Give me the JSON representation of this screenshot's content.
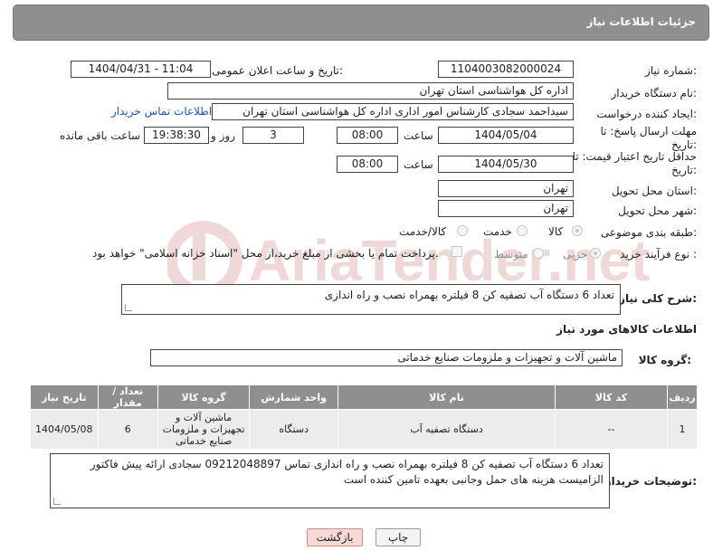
{
  "header": {
    "title": "جزئیات اطلاعات نیاز"
  },
  "fields": {
    "need_number_label": "شماره نیاز:",
    "need_number": "1104003082000024",
    "announce_label": "تاریخ و ساعت اعلان عمومی:",
    "announce_value": "1404/04/31 - 11:04",
    "buyer_org_label": "نام دستگاه خریدار:",
    "buyer_org": "اداره کل هواشناسی استان تهران",
    "requester_label": "ایجاد کننده درخواست:",
    "requester": "سیداحمد سجادی کارشناس امور اداری اداره کل هواشناسی استان تهران",
    "buyer_contact_link": "اطلاعات تماس خریدار",
    "deadline_label": "مهلت ارسال پاسخ: تا تاریخ:",
    "deadline_date": "1404/05/04",
    "time_label": "ساعت",
    "deadline_time": "08:00",
    "days_count": "3",
    "days_label": "روز و",
    "remaining_time": "19:38:30",
    "remaining_label": "ساعت باقی مانده",
    "validity_label": "حداقل تاریخ اعتبار قیمت: تا تاریخ:",
    "validity_date": "1404/05/30",
    "validity_time": "08:00",
    "province_label": "استان محل تحویل:",
    "province": "تهران",
    "city_label": "شهر محل تحویل:",
    "city": "تهران",
    "category_label": "طبقه بندی موضوعی:",
    "category_options": [
      "کالا",
      "خدمت",
      "کالا/خدمت"
    ],
    "process_label": "نوع فرآیند خرید :",
    "process_options": [
      "جزیی",
      "متوسط"
    ],
    "payment_note": "پرداخت تمام یا بخشی از مبلغ خرید،از محل \"اسناد خزانه اسلامی\" خواهد بود."
  },
  "summary": {
    "label": "شرح کلی نیاز:",
    "text": "تعداد 6 دستگاه آب تصفیه کن 8 فیلتره  بهمراه نصب و راه اندازی"
  },
  "goods_section": {
    "title": "اطلاعات کالاهای مورد نیاز",
    "group_label": "گروه کالا:",
    "group_value": "ماشین آلات و تجهیزات و ملزومات صنایع خدماتی"
  },
  "table": {
    "headers": [
      "ردیف",
      "کد کالا",
      "نام کالا",
      "واحد شمارش",
      "گروه کالا",
      "تعداد / مقدار",
      "تاریخ نیاز"
    ],
    "rows": [
      [
        "1",
        "--",
        "دستگاه تصفیه آب",
        "دستگاه",
        "ماشین آلات و تجهیزات و ملزومات صنایع خدماتی",
        "6",
        "1404/05/08"
      ]
    ]
  },
  "buyer_notes": {
    "label": "توضیحات خریدار:",
    "text": "تعداد 6 دستگاه آب تصفیه کن 8 فیلتره  بهمراه نصب و راه اندازی  تماس 09212048897 سجادی ارائه پیش فاکتور الزامیست هزینه های حمل وجانبی بعهده تامین کننده است"
  },
  "buttons": {
    "print": "چاپ",
    "back": "بازگشت"
  },
  "watermark": {
    "text": "AriaTender.net",
    "color": "#b03030"
  }
}
